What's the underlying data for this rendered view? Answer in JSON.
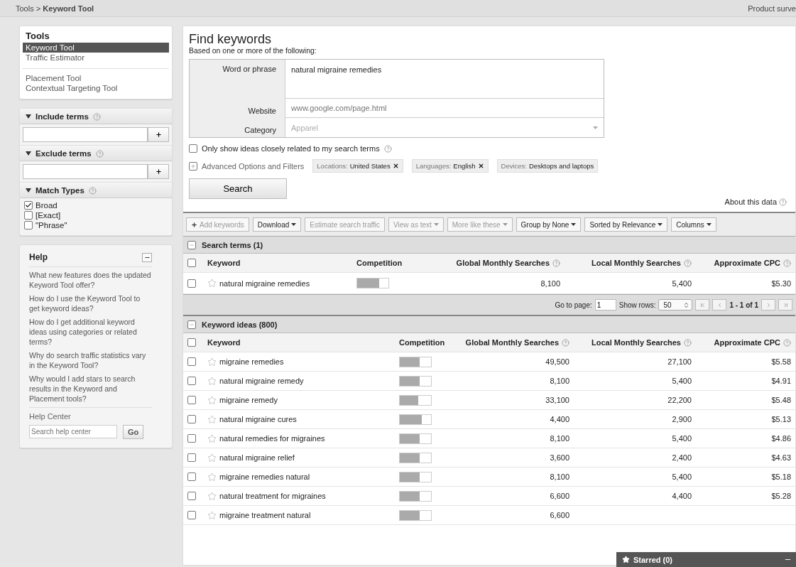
{
  "breadcrumb": {
    "parent": "Tools",
    "separator": ">",
    "current": "Keyword Tool"
  },
  "top_link": "Product surve",
  "sidebar": {
    "title": "Tools",
    "groups": [
      [
        {
          "label": "Keyword Tool",
          "selected": true
        },
        {
          "label": "Traffic Estimator",
          "selected": false
        }
      ],
      [
        {
          "label": "Placement Tool",
          "selected": false
        },
        {
          "label": "Contextual Targeting Tool",
          "selected": false
        }
      ]
    ]
  },
  "filters": [
    {
      "title": "Include terms",
      "kind": "field",
      "expanded": true
    },
    {
      "title": "Exclude terms",
      "kind": "field",
      "expanded": true
    },
    {
      "title": "Match Types",
      "kind": "checks",
      "expanded": true,
      "options": [
        {
          "label": "Broad",
          "checked": true
        },
        {
          "label": "[Exact]",
          "checked": false
        },
        {
          "label": "\"Phrase\"",
          "checked": false
        }
      ]
    }
  ],
  "help": {
    "title": "Help",
    "links": [
      "What new features does the updated Keyword Tool offer?",
      "How do I use the Keyword Tool to get keyword ideas?",
      "How do I get additional keyword ideas using categories or related terms?",
      "Why do search traffic statistics vary in the Keyword Tool?",
      "Why would I add stars to search results in the Keyword and Placement tools?"
    ],
    "center_label": "Help Center",
    "search_placeholder": "Search help center",
    "go": "Go"
  },
  "find": {
    "title": "Find keywords",
    "subtitle": "Based on one or more of the following:",
    "fields": [
      {
        "label": "Word or phrase",
        "kind": "textarea",
        "value": "natural migraine remedies"
      },
      {
        "label": "Website",
        "kind": "text",
        "placeholder": "www.google.com/page.html"
      },
      {
        "label": "Category",
        "kind": "dropdown",
        "placeholder": "Apparel"
      }
    ],
    "related_only": {
      "label": "Only show ideas closely related to my search terms",
      "checked": false
    },
    "advanced": {
      "label": "Advanced Options and Filters",
      "expanded": false
    },
    "chips": [
      {
        "name": "Locations:",
        "value": "United States",
        "removable": true
      },
      {
        "name": "Languages:",
        "value": "English",
        "removable": true
      },
      {
        "name": "Devices:",
        "value": "Desktops and laptops",
        "removable": false
      }
    ],
    "search_button": "Search",
    "about": "About this data"
  },
  "toolbar": [
    {
      "label": "Add keywords",
      "kind": "add",
      "disabled": true
    },
    {
      "label": "Download",
      "kind": "menu",
      "disabled": false
    },
    {
      "label": "Estimate search traffic",
      "kind": "plain",
      "disabled": true
    },
    {
      "label": "View as text",
      "kind": "menu",
      "disabled": true
    },
    {
      "label": "More like these",
      "kind": "menu",
      "disabled": true
    },
    {
      "label": "Group by None",
      "kind": "menu",
      "disabled": false
    },
    {
      "label": "Sorted by Relevance",
      "kind": "menu",
      "disabled": false
    },
    {
      "label": "Columns",
      "kind": "menu",
      "disabled": false
    }
  ],
  "search_terms": {
    "title": "Search terms (1)",
    "expanded": true,
    "all_checked": false,
    "columns": [
      "Keyword",
      "Competition",
      "Global Monthly Searches",
      "Local Monthly Searches",
      "Approximate CPC"
    ],
    "rows": [
      {
        "keyword": "natural migraine remedies",
        "checked": false,
        "starred": false,
        "level": 0.7,
        "global": "8,100",
        "local": "5,400",
        "cpc": "$5.30"
      }
    ],
    "pagination": {
      "go_label": "Go to page:",
      "page": "1",
      "rows_label": "Show rows:",
      "rows": "50",
      "range": "1 - 1 of 1"
    }
  },
  "keyword_ideas": {
    "title": "Keyword ideas (800)",
    "expanded": true,
    "all_checked": false,
    "columns": [
      "Keyword",
      "Competition",
      "Global Monthly Searches",
      "Local Monthly Searches",
      "Approximate CPC"
    ],
    "rows": [
      {
        "keyword": "migraine remedies",
        "checked": false,
        "starred": false,
        "level": 0.63,
        "global": "49,500",
        "local": "27,100",
        "cpc": "$5.58"
      },
      {
        "keyword": "natural migraine remedy",
        "checked": false,
        "starred": false,
        "level": 0.63,
        "global": "8,100",
        "local": "5,400",
        "cpc": "$4.91"
      },
      {
        "keyword": "migraine remedy",
        "checked": false,
        "starred": false,
        "level": 0.6,
        "global": "33,100",
        "local": "22,200",
        "cpc": "$5.48"
      },
      {
        "keyword": "natural migraine cures",
        "checked": false,
        "starred": false,
        "level": 0.7,
        "global": "4,400",
        "local": "2,900",
        "cpc": "$5.13"
      },
      {
        "keyword": "natural remedies for migraines",
        "checked": false,
        "starred": false,
        "level": 0.63,
        "global": "8,100",
        "local": "5,400",
        "cpc": "$4.86"
      },
      {
        "keyword": "natural migraine relief",
        "checked": false,
        "starred": false,
        "level": 0.63,
        "global": "3,600",
        "local": "2,400",
        "cpc": "$4.63"
      },
      {
        "keyword": "migraine remedies natural",
        "checked": false,
        "starred": false,
        "level": 0.63,
        "global": "8,100",
        "local": "5,400",
        "cpc": "$5.18"
      },
      {
        "keyword": "natural treatment for migraines",
        "checked": false,
        "starred": false,
        "level": 0.63,
        "global": "6,600",
        "local": "4,400",
        "cpc": "$5.28"
      },
      {
        "keyword": "migraine treatment natural",
        "checked": false,
        "starred": false,
        "level": 0.63,
        "global": "6,600"
      }
    ]
  },
  "starred_bar": {
    "label": "Starred (0)"
  }
}
